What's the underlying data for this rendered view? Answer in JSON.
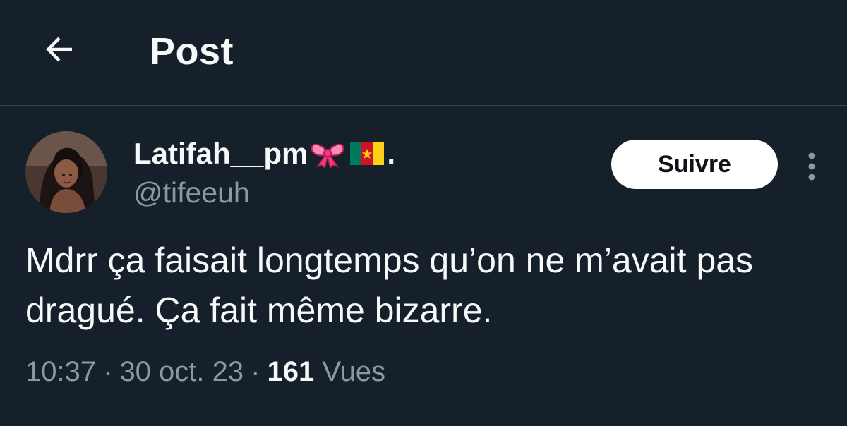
{
  "header": {
    "title": "Post",
    "back_icon": "arrow-left-icon"
  },
  "author": {
    "name": "Latifah__pm",
    "name_suffix": ".",
    "emoji_icons": [
      "ribbon-bow-icon",
      "cameroon-flag-icon"
    ],
    "handle": "@tifeeuh"
  },
  "actions": {
    "follow_label": "Suivre",
    "more_icon": "vertical-dots-icon"
  },
  "tweet": {
    "text": "Mdrr ça faisait longtemps qu’on ne m’avait pas dragué. Ça fait même bizarre."
  },
  "meta": {
    "time": "10:37",
    "separator": "·",
    "date": "30 oct. 23",
    "views_count": "161",
    "views_label": "Vues"
  },
  "colors": {
    "background": "#15202b",
    "text_primary": "#f7f9f9",
    "text_secondary": "#8b98a5",
    "divider": "#38444d",
    "follow_bg": "#ffffff",
    "follow_text": "#0f1419"
  }
}
